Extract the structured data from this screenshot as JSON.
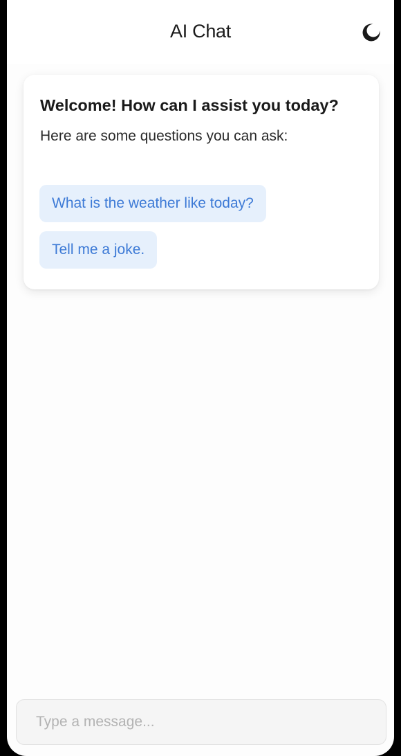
{
  "header": {
    "title": "AI Chat",
    "theme_icon": "moon-icon"
  },
  "welcome_card": {
    "heading": "Welcome! How can I assist you today?",
    "subtitle": "Here are some questions you can ask:",
    "suggestions": [
      {
        "label": "What is the weather like today?"
      },
      {
        "label": "Tell me a joke."
      }
    ]
  },
  "composer": {
    "placeholder": "Type a message..."
  },
  "colors": {
    "suggestion_bg": "#e6f0fc",
    "suggestion_text": "#3d7ad6",
    "text": "#1a1a1a"
  }
}
